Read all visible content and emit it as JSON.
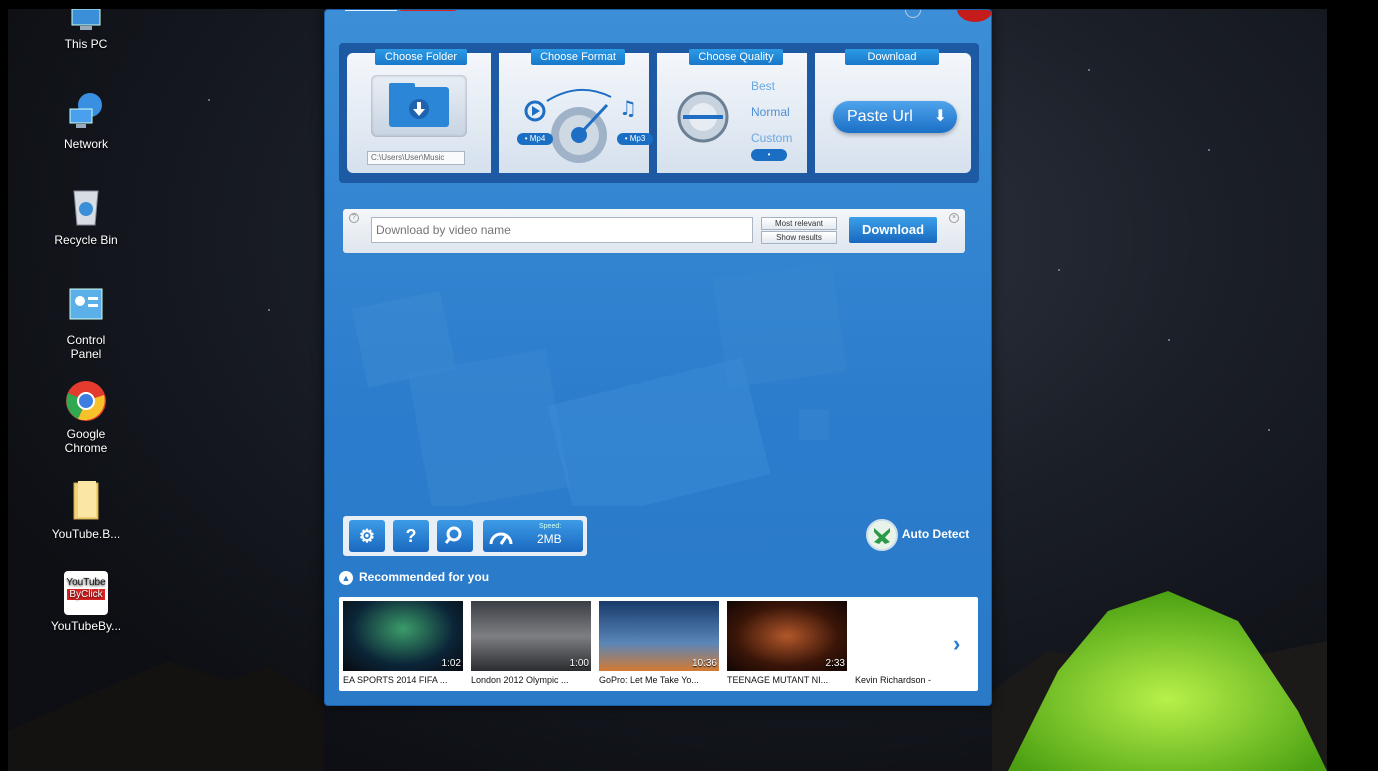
{
  "desktop": {
    "icons": [
      {
        "label": "This PC",
        "icon": "this-pc-icon"
      },
      {
        "label": "Network",
        "icon": "network-icon"
      },
      {
        "label": "Recycle Bin",
        "icon": "recycle-bin-icon"
      },
      {
        "label": "Control Panel",
        "icon": "control-panel-icon"
      },
      {
        "label": "Google Chrome",
        "icon": "chrome-icon"
      },
      {
        "label": "YouTube.B...",
        "icon": "folder-icon"
      },
      {
        "label": "YouTubeBy...",
        "icon": "youtube-byclick-icon"
      }
    ],
    "ytclick_logo_line1": "YouTube",
    "ytclick_logo_line2": "ByClick"
  },
  "app": {
    "steps": {
      "folder_tab": "Choose Folder",
      "folder_path": "C:\\Users\\User\\Music",
      "format_tab": "Choose Format",
      "mp4_label": "• Mp4",
      "mp3_label": "• Mp3",
      "quality_tab": "Choose Quality",
      "quality_best": "Best",
      "quality_normal": "Normal",
      "quality_custom": "Custom",
      "download_tab": "Download",
      "paste_url_label": "Paste Url"
    },
    "search": {
      "placeholder": "Download by video name",
      "most_relevant_label": "Most relevant",
      "show_results_label": "Show results",
      "download_label": "Download"
    },
    "toolbar": {
      "settings_icon": "gear-icon",
      "help_label": "?",
      "search_icon": "search-icon",
      "speed_label": "Speed:",
      "speed_value": "2MB"
    },
    "auto_detect_label": "Auto Detect",
    "recommended": {
      "header": "Recommended for you",
      "videos": [
        {
          "title": "EA SPORTS 2014 FIFA ...",
          "duration": "1:02"
        },
        {
          "title": "London 2012 Olympic ...",
          "duration": "1:00"
        },
        {
          "title": "GoPro: Let Me Take Yo...",
          "duration": "10:36"
        },
        {
          "title": "TEENAGE MUTANT NI...",
          "duration": "2:33"
        },
        {
          "title": "Kevin Richardson - ",
          "duration": ""
        }
      ]
    }
  },
  "colors": {
    "app_blue": "#2b7ccc",
    "tab_blue": "#1877c9",
    "close_red": "#c51b1b",
    "tent_green": "#7fd82a"
  }
}
